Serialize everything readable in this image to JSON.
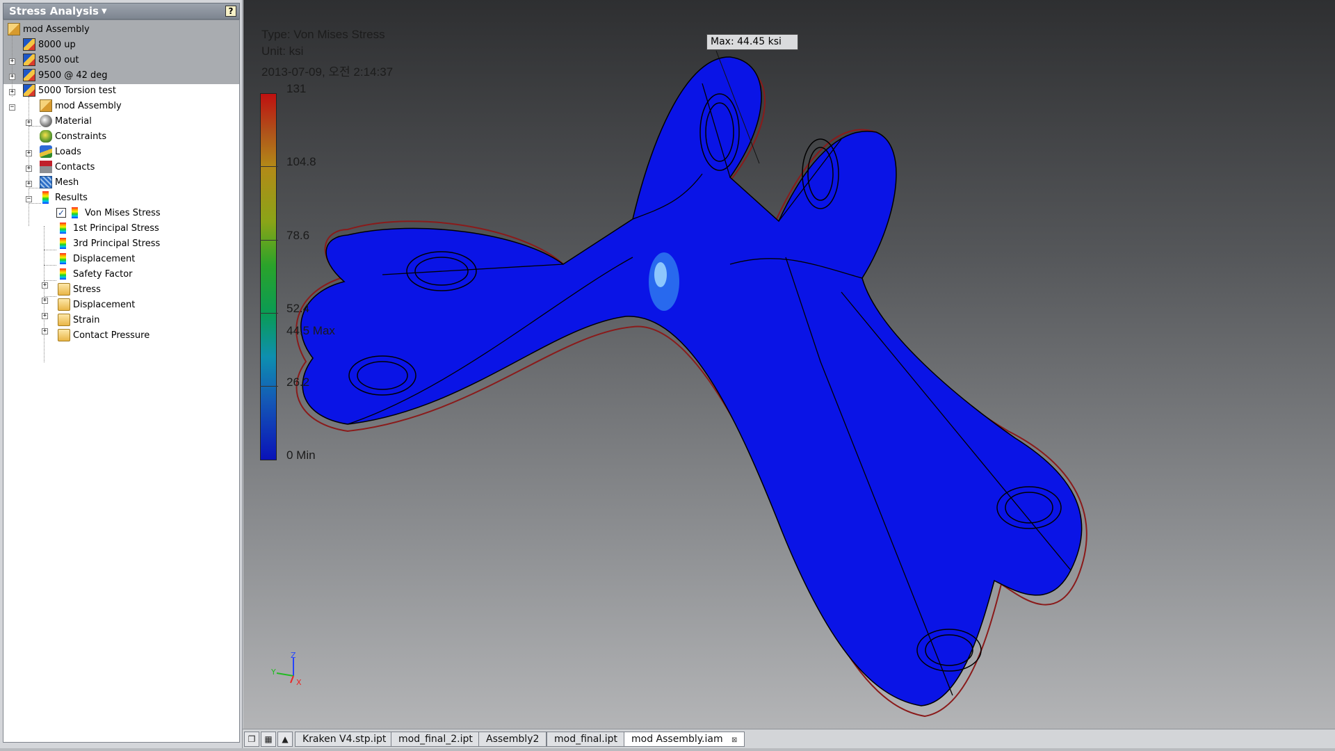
{
  "panel": {
    "title": "Stress Analysis",
    "help_icon": "?",
    "tree": [
      {
        "label": "mod Assembly",
        "icon": "assembly-icon"
      },
      {
        "label": "8000 up",
        "icon": "study-icon"
      },
      {
        "label": "8500 out",
        "icon": "study-icon"
      },
      {
        "label": "9500 @ 42 deg",
        "icon": "study-icon"
      },
      {
        "label": "5000 Torsion test",
        "icon": "study-icon"
      },
      {
        "label": "mod Assembly",
        "icon": "assembly-icon"
      },
      {
        "label": "Material",
        "icon": "material-icon"
      },
      {
        "label": "Constraints",
        "icon": "constraints-icon"
      },
      {
        "label": "Loads",
        "icon": "loads-icon"
      },
      {
        "label": "Contacts",
        "icon": "contacts-icon"
      },
      {
        "label": "Mesh",
        "icon": "mesh-icon"
      },
      {
        "label": "Results",
        "icon": "results-icon"
      },
      {
        "label": "Von Mises Stress",
        "icon": "result-plot-icon",
        "checked": true
      },
      {
        "label": "1st Principal Stress",
        "icon": "result-plot-icon"
      },
      {
        "label": "3rd Principal Stress",
        "icon": "result-plot-icon"
      },
      {
        "label": "Displacement",
        "icon": "result-plot-icon"
      },
      {
        "label": "Safety Factor",
        "icon": "result-plot-icon"
      },
      {
        "label": "Stress",
        "icon": "folder-icon"
      },
      {
        "label": "Displacement",
        "icon": "folder-icon"
      },
      {
        "label": "Strain",
        "icon": "folder-icon"
      },
      {
        "label": "Contact Pressure",
        "icon": "folder-icon"
      }
    ]
  },
  "viewport": {
    "type_line": "Type: Von Mises Stress",
    "unit_line": "Unit: ksi",
    "date_line": "2013-07-09, 오전 2:14:37",
    "max_callout": "Max: 44.45 ksi",
    "legend": {
      "labels": [
        "131",
        "104.8",
        "78.6",
        "52.4",
        "44.5 Max",
        "26.2",
        "0 Min"
      ],
      "colors": [
        "#c01010",
        "#b38a18",
        "#2aa32a",
        "#0e8fb0",
        "#0a12b8"
      ]
    },
    "model_color": "#0a14e6",
    "triad_labels": {
      "x": "X",
      "y": "Y",
      "z": "Z"
    }
  },
  "tabs": {
    "items": [
      "Kraken V4.stp.ipt",
      "mod_final_2.ipt",
      "Assembly2",
      "mod_final.ipt",
      "mod Assembly.iam"
    ],
    "active": "mod Assembly.iam",
    "close_glyph": "⊠"
  }
}
